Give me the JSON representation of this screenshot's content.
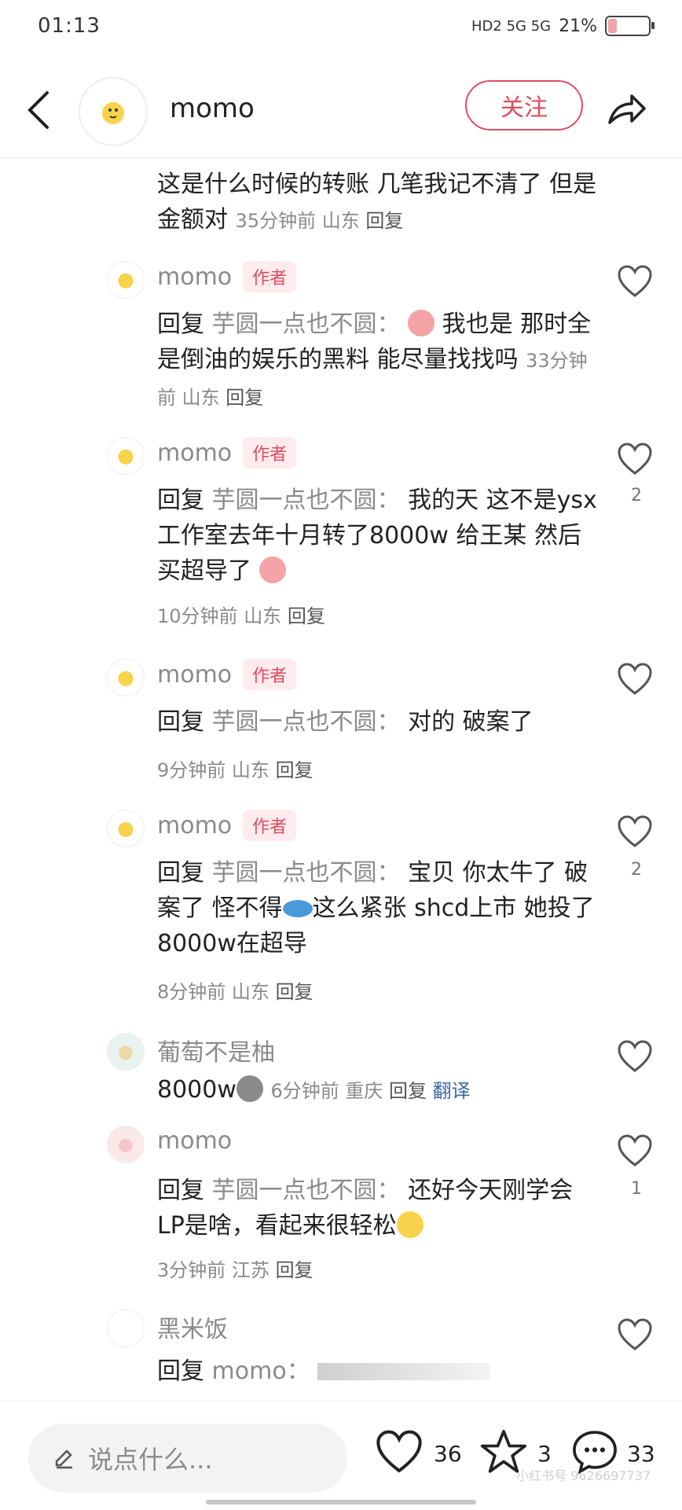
{
  "status_bar": {
    "time": "01:13",
    "network": "HD2  5G  5G",
    "battery_label": "21%",
    "battery_level": 0.21
  },
  "header": {
    "name": "momo",
    "follow_label": "关注"
  },
  "comments": [
    {
      "text": "这是什么时候的转账 几笔我记不清了 但是金额对",
      "time": "35分钟前",
      "location": "山东",
      "reply_label": "回复"
    },
    {
      "name": "momo",
      "tag": "作者",
      "prefix": "回复",
      "to": "芋圆一点也不圆：",
      "text": "我也是 那时全是倒油的娱乐的黑料 能尽量找找吗",
      "time": "33分钟前",
      "location": "山东",
      "reply_label": "回复"
    },
    {
      "name": "momo",
      "tag": "作者",
      "prefix": "回复",
      "to": "芋圆一点也不圆：",
      "text": "我的天 这不是ysx工作室去年十月转了8000w 给王某 然后买超导了",
      "time": "10分钟前",
      "location": "山东",
      "reply_label": "回复",
      "likes": "2"
    },
    {
      "name": "momo",
      "tag": "作者",
      "prefix": "回复",
      "to": "芋圆一点也不圆：",
      "text": "对的 破案了",
      "time": "9分钟前",
      "location": "山东",
      "reply_label": "回复"
    },
    {
      "name": "momo",
      "tag": "作者",
      "prefix": "回复",
      "to": "芋圆一点也不圆：",
      "text": "宝贝 你太牛了 破案了 怪不得",
      "text2": "这么紧张 shcd上市 她投了8000w在超导",
      "time": "8分钟前",
      "location": "山东",
      "reply_label": "回复",
      "likes": "2"
    },
    {
      "name": "葡萄不是柚",
      "text": "8000w",
      "time": "6分钟前",
      "location": "重庆",
      "reply_label": "回复",
      "translate_label": "翻译"
    },
    {
      "name": "momo",
      "prefix": "回复",
      "to": "芋圆一点也不圆：",
      "text": "还好今天刚学会LP是啥，看起来很轻松",
      "time": "3分钟前",
      "location": "江苏",
      "reply_label": "回复",
      "likes": "1"
    },
    {
      "name": "黑米饭",
      "prefix": "回复",
      "to": "momo："
    }
  ],
  "bottom_bar": {
    "placeholder": "说点什么...",
    "likes": "36",
    "stars": "3",
    "comments": "33"
  },
  "watermark": "小红书号 9626697737",
  "colors": {
    "accent": "#e04c5f",
    "muted": "#8a8a8a"
  }
}
